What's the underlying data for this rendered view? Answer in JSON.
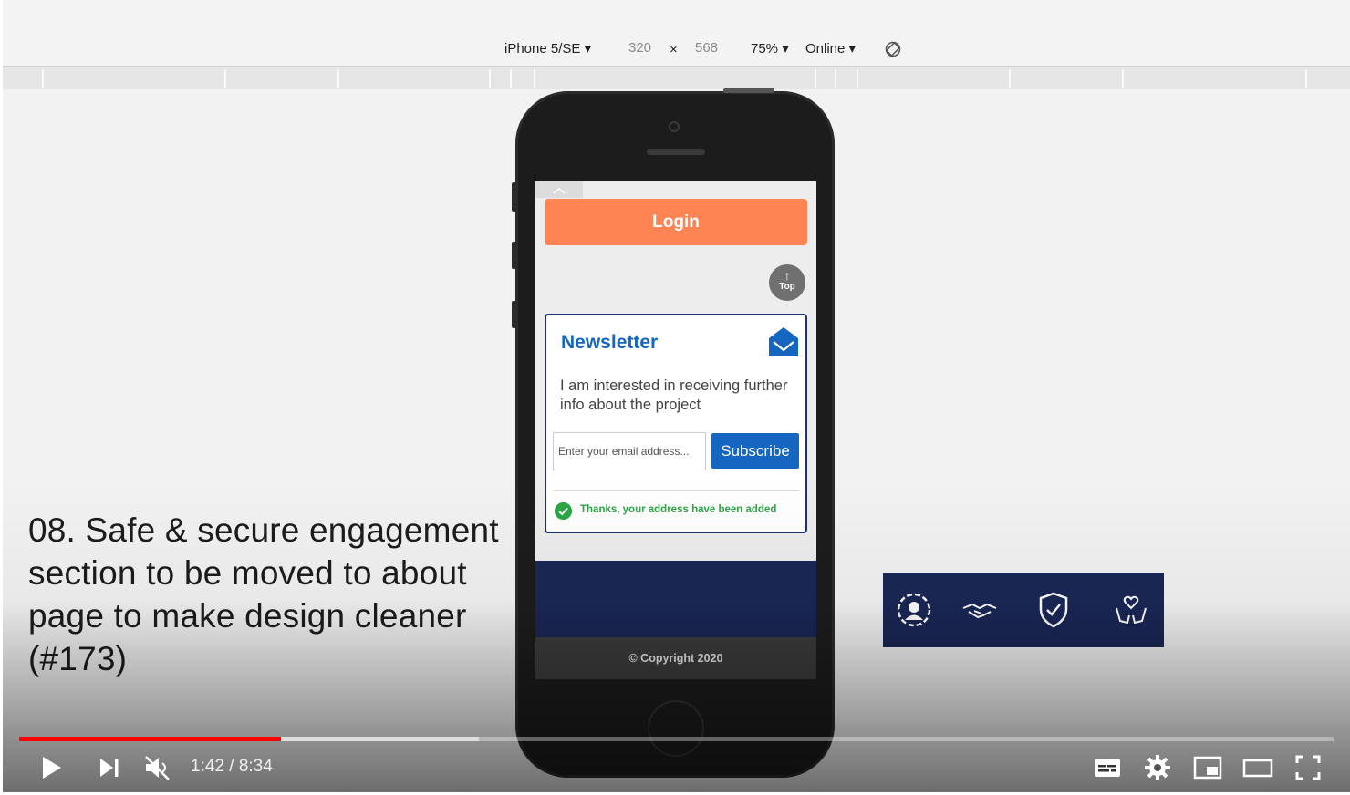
{
  "devtools": {
    "device": "iPhone 5/SE",
    "device_caret": "▾",
    "width": "320",
    "times": "×",
    "height": "568",
    "zoom": "75%",
    "zoom_caret": "▾",
    "network": "Online",
    "network_caret": "▾",
    "rotate_icon": "rotate-icon"
  },
  "phone_screen": {
    "login_label": "Login",
    "top_button": {
      "arrow": "↑",
      "label": "Top"
    },
    "newsletter": {
      "title": "Newsletter",
      "icon": "envelope-icon",
      "body": "I am interested in receiving further info about the project",
      "email_placeholder": "Enter your email address...",
      "subscribe_label": "Subscribe",
      "success_message": "Thanks, your address have been added"
    },
    "copyright": "© Copyright 2020"
  },
  "caption": "08. Safe & secure engagement section to be moved to about page to make design cleaner (#173)",
  "engagement_icons": [
    "people-circle-icon",
    "handshake-icon",
    "shield-check-icon",
    "hands-heart-icon"
  ],
  "video": {
    "time_display": "1:42 / 8:34",
    "played_fraction": 0.199,
    "buffered_fraction": 0.35,
    "progress_color": "#ff0000"
  },
  "colors": {
    "login": "#ff8453",
    "brand_blue": "#1466c0",
    "navy": "#1a2755",
    "success_green": "#2aa645"
  }
}
